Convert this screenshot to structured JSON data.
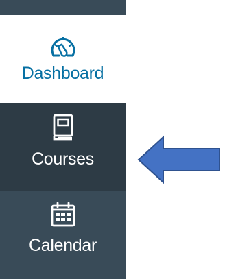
{
  "nav": {
    "items": [
      {
        "label": "Dashboard",
        "icon": "dashboard-icon",
        "active": false
      },
      {
        "label": "Courses",
        "icon": "book-icon",
        "active": true
      },
      {
        "label": "Calendar",
        "icon": "calendar-icon",
        "active": false
      }
    ]
  },
  "annotation": {
    "arrow": "arrow-left-icon",
    "color": "#4472c4"
  },
  "colors": {
    "nav_dark": "#2d3b45",
    "nav_medium": "#394b58",
    "link_blue": "#0770a3"
  }
}
